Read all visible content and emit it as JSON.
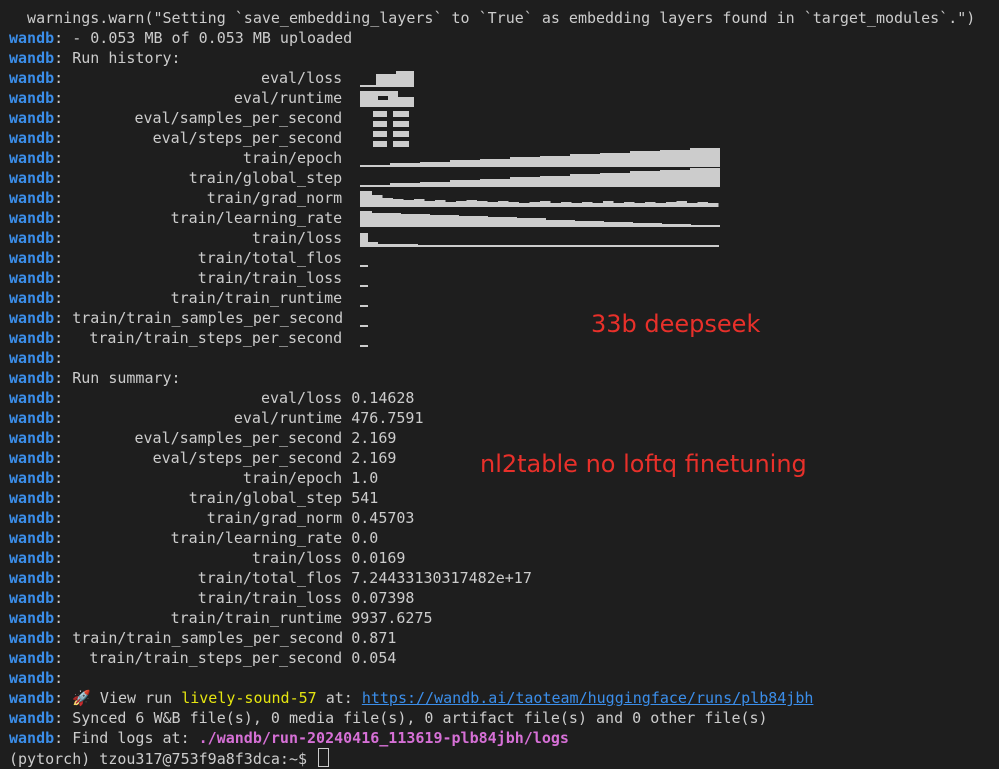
{
  "terminal": {
    "warning_line": "  warnings.warn(\"Setting `save_embedding_layers` to `True` as embedding layers found in `target_modules`.\")",
    "prefix": "wandb",
    "upload_status": "- 0.053 MB of 0.053 MB uploaded",
    "run_history_header": "Run history:",
    "run_summary_header": "Run summary:",
    "history_rows": [
      {
        "key": "eval/loss",
        "pattern": "evalloss"
      },
      {
        "key": "eval/runtime",
        "pattern": "evalblock"
      },
      {
        "key": "eval/samples_per_second",
        "pattern": "evalblock2"
      },
      {
        "key": "eval/steps_per_second",
        "pattern": "evalblock2"
      },
      {
        "key": "train/epoch",
        "pattern": "rising"
      },
      {
        "key": "train/global_step",
        "pattern": "rising"
      },
      {
        "key": "train/grad_norm",
        "pattern": "falling"
      },
      {
        "key": "train/learning_rate",
        "pattern": "falling2"
      },
      {
        "key": "train/loss",
        "pattern": "flatlow"
      },
      {
        "key": "train/total_flos",
        "pattern": "single"
      },
      {
        "key": "train/train_loss",
        "pattern": "single"
      },
      {
        "key": "train/train_runtime",
        "pattern": "single"
      },
      {
        "key": "train/train_samples_per_second",
        "pattern": "single"
      },
      {
        "key": "train/train_steps_per_second",
        "pattern": "single"
      }
    ],
    "summary_rows": [
      {
        "key": "eval/loss",
        "value": "0.14628"
      },
      {
        "key": "eval/runtime",
        "value": "476.7591"
      },
      {
        "key": "eval/samples_per_second",
        "value": "2.169"
      },
      {
        "key": "eval/steps_per_second",
        "value": "2.169"
      },
      {
        "key": "train/epoch",
        "value": "1.0"
      },
      {
        "key": "train/global_step",
        "value": "541"
      },
      {
        "key": "train/grad_norm",
        "value": "0.45703"
      },
      {
        "key": "train/learning_rate",
        "value": "0.0"
      },
      {
        "key": "train/loss",
        "value": "0.0169"
      },
      {
        "key": "train/total_flos",
        "value": "7.24433130317482e+17"
      },
      {
        "key": "train/train_loss",
        "value": "0.07398"
      },
      {
        "key": "train/train_runtime",
        "value": "9937.6275"
      },
      {
        "key": "train/train_samples_per_second",
        "value": "0.871"
      },
      {
        "key": "train/train_steps_per_second",
        "value": "0.054"
      }
    ],
    "view_run": {
      "emoji": "🚀",
      "prefix_text": " View run ",
      "run_name": "lively-sound-57",
      "at_text": " at: ",
      "url": "https://wandb.ai/taoteam/huggingface/runs/plb84jbh"
    },
    "synced_text": "Synced 6 W&B file(s), 0 media file(s), 0 artifact file(s) and 0 other file(s)",
    "find_logs_text": "Find logs at: ",
    "logs_path": "./wandb/run-20240416_113619-plb84jbh/logs",
    "prompt": "(pytorch) tzou317@753f9a8f3dca:~$ "
  },
  "annotations": {
    "model_note": "33b deepseek",
    "task_note": "nl2table no loftq finetuning"
  },
  "colors": {
    "background": "#1e1e1e",
    "wandb_prefix": "#3b8eea",
    "annotation": "#e8302a",
    "run_name": "#e5e510",
    "logs_path": "#d670d6"
  }
}
